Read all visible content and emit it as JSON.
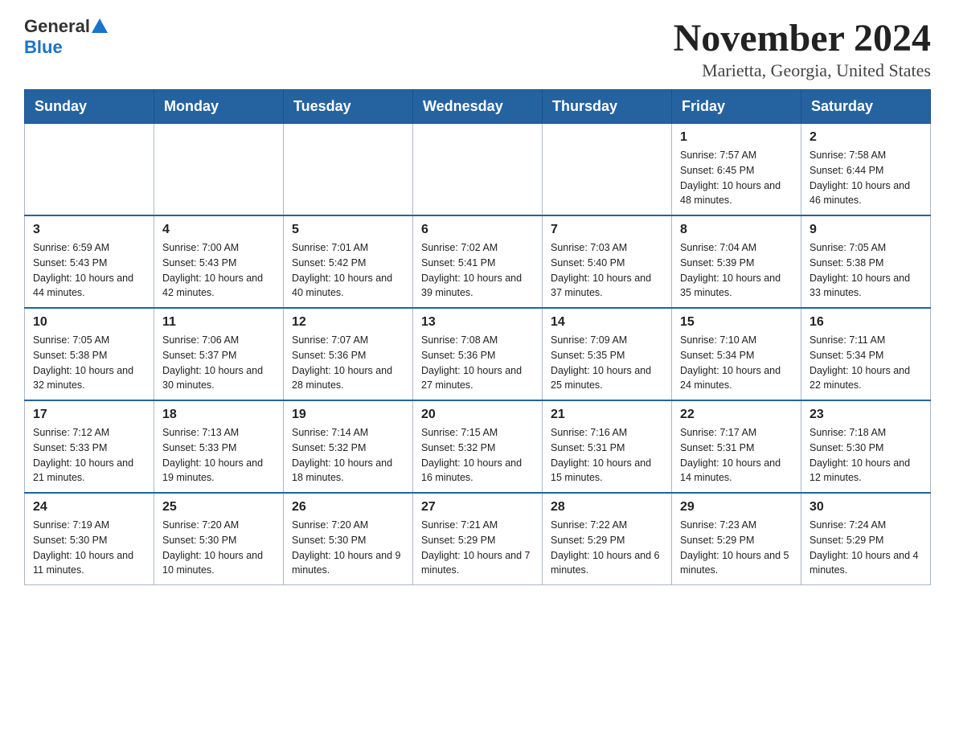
{
  "header": {
    "logo_general": "General",
    "logo_blue": "Blue",
    "title": "November 2024",
    "subtitle": "Marietta, Georgia, United States"
  },
  "days_of_week": [
    "Sunday",
    "Monday",
    "Tuesday",
    "Wednesday",
    "Thursday",
    "Friday",
    "Saturday"
  ],
  "weeks": [
    [
      {
        "day": "",
        "sunrise": "",
        "sunset": "",
        "daylight": ""
      },
      {
        "day": "",
        "sunrise": "",
        "sunset": "",
        "daylight": ""
      },
      {
        "day": "",
        "sunrise": "",
        "sunset": "",
        "daylight": ""
      },
      {
        "day": "",
        "sunrise": "",
        "sunset": "",
        "daylight": ""
      },
      {
        "day": "",
        "sunrise": "",
        "sunset": "",
        "daylight": ""
      },
      {
        "day": "1",
        "sunrise": "Sunrise: 7:57 AM",
        "sunset": "Sunset: 6:45 PM",
        "daylight": "Daylight: 10 hours and 48 minutes."
      },
      {
        "day": "2",
        "sunrise": "Sunrise: 7:58 AM",
        "sunset": "Sunset: 6:44 PM",
        "daylight": "Daylight: 10 hours and 46 minutes."
      }
    ],
    [
      {
        "day": "3",
        "sunrise": "Sunrise: 6:59 AM",
        "sunset": "Sunset: 5:43 PM",
        "daylight": "Daylight: 10 hours and 44 minutes."
      },
      {
        "day": "4",
        "sunrise": "Sunrise: 7:00 AM",
        "sunset": "Sunset: 5:43 PM",
        "daylight": "Daylight: 10 hours and 42 minutes."
      },
      {
        "day": "5",
        "sunrise": "Sunrise: 7:01 AM",
        "sunset": "Sunset: 5:42 PM",
        "daylight": "Daylight: 10 hours and 40 minutes."
      },
      {
        "day": "6",
        "sunrise": "Sunrise: 7:02 AM",
        "sunset": "Sunset: 5:41 PM",
        "daylight": "Daylight: 10 hours and 39 minutes."
      },
      {
        "day": "7",
        "sunrise": "Sunrise: 7:03 AM",
        "sunset": "Sunset: 5:40 PM",
        "daylight": "Daylight: 10 hours and 37 minutes."
      },
      {
        "day": "8",
        "sunrise": "Sunrise: 7:04 AM",
        "sunset": "Sunset: 5:39 PM",
        "daylight": "Daylight: 10 hours and 35 minutes."
      },
      {
        "day": "9",
        "sunrise": "Sunrise: 7:05 AM",
        "sunset": "Sunset: 5:38 PM",
        "daylight": "Daylight: 10 hours and 33 minutes."
      }
    ],
    [
      {
        "day": "10",
        "sunrise": "Sunrise: 7:05 AM",
        "sunset": "Sunset: 5:38 PM",
        "daylight": "Daylight: 10 hours and 32 minutes."
      },
      {
        "day": "11",
        "sunrise": "Sunrise: 7:06 AM",
        "sunset": "Sunset: 5:37 PM",
        "daylight": "Daylight: 10 hours and 30 minutes."
      },
      {
        "day": "12",
        "sunrise": "Sunrise: 7:07 AM",
        "sunset": "Sunset: 5:36 PM",
        "daylight": "Daylight: 10 hours and 28 minutes."
      },
      {
        "day": "13",
        "sunrise": "Sunrise: 7:08 AM",
        "sunset": "Sunset: 5:36 PM",
        "daylight": "Daylight: 10 hours and 27 minutes."
      },
      {
        "day": "14",
        "sunrise": "Sunrise: 7:09 AM",
        "sunset": "Sunset: 5:35 PM",
        "daylight": "Daylight: 10 hours and 25 minutes."
      },
      {
        "day": "15",
        "sunrise": "Sunrise: 7:10 AM",
        "sunset": "Sunset: 5:34 PM",
        "daylight": "Daylight: 10 hours and 24 minutes."
      },
      {
        "day": "16",
        "sunrise": "Sunrise: 7:11 AM",
        "sunset": "Sunset: 5:34 PM",
        "daylight": "Daylight: 10 hours and 22 minutes."
      }
    ],
    [
      {
        "day": "17",
        "sunrise": "Sunrise: 7:12 AM",
        "sunset": "Sunset: 5:33 PM",
        "daylight": "Daylight: 10 hours and 21 minutes."
      },
      {
        "day": "18",
        "sunrise": "Sunrise: 7:13 AM",
        "sunset": "Sunset: 5:33 PM",
        "daylight": "Daylight: 10 hours and 19 minutes."
      },
      {
        "day": "19",
        "sunrise": "Sunrise: 7:14 AM",
        "sunset": "Sunset: 5:32 PM",
        "daylight": "Daylight: 10 hours and 18 minutes."
      },
      {
        "day": "20",
        "sunrise": "Sunrise: 7:15 AM",
        "sunset": "Sunset: 5:32 PM",
        "daylight": "Daylight: 10 hours and 16 minutes."
      },
      {
        "day": "21",
        "sunrise": "Sunrise: 7:16 AM",
        "sunset": "Sunset: 5:31 PM",
        "daylight": "Daylight: 10 hours and 15 minutes."
      },
      {
        "day": "22",
        "sunrise": "Sunrise: 7:17 AM",
        "sunset": "Sunset: 5:31 PM",
        "daylight": "Daylight: 10 hours and 14 minutes."
      },
      {
        "day": "23",
        "sunrise": "Sunrise: 7:18 AM",
        "sunset": "Sunset: 5:30 PM",
        "daylight": "Daylight: 10 hours and 12 minutes."
      }
    ],
    [
      {
        "day": "24",
        "sunrise": "Sunrise: 7:19 AM",
        "sunset": "Sunset: 5:30 PM",
        "daylight": "Daylight: 10 hours and 11 minutes."
      },
      {
        "day": "25",
        "sunrise": "Sunrise: 7:20 AM",
        "sunset": "Sunset: 5:30 PM",
        "daylight": "Daylight: 10 hours and 10 minutes."
      },
      {
        "day": "26",
        "sunrise": "Sunrise: 7:20 AM",
        "sunset": "Sunset: 5:30 PM",
        "daylight": "Daylight: 10 hours and 9 minutes."
      },
      {
        "day": "27",
        "sunrise": "Sunrise: 7:21 AM",
        "sunset": "Sunset: 5:29 PM",
        "daylight": "Daylight: 10 hours and 7 minutes."
      },
      {
        "day": "28",
        "sunrise": "Sunrise: 7:22 AM",
        "sunset": "Sunset: 5:29 PM",
        "daylight": "Daylight: 10 hours and 6 minutes."
      },
      {
        "day": "29",
        "sunrise": "Sunrise: 7:23 AM",
        "sunset": "Sunset: 5:29 PM",
        "daylight": "Daylight: 10 hours and 5 minutes."
      },
      {
        "day": "30",
        "sunrise": "Sunrise: 7:24 AM",
        "sunset": "Sunset: 5:29 PM",
        "daylight": "Daylight: 10 hours and 4 minutes."
      }
    ]
  ]
}
